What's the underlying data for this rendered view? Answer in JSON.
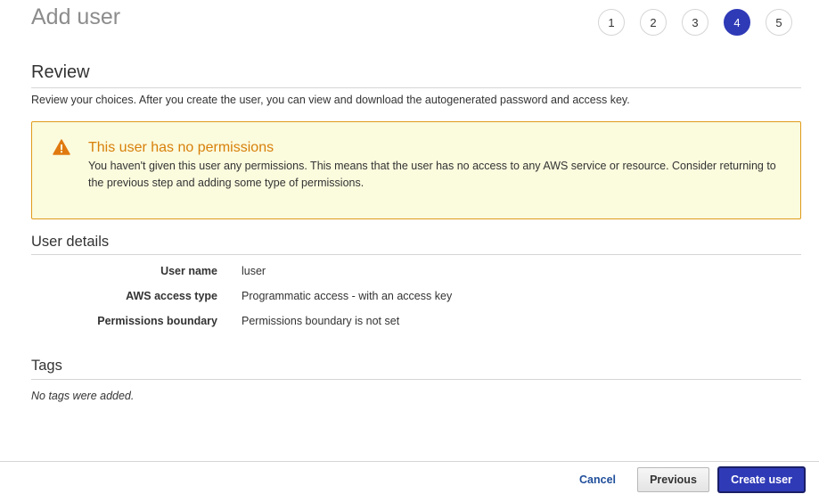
{
  "page_title": "Add user",
  "steps": [
    {
      "label": "1",
      "active": false
    },
    {
      "label": "2",
      "active": false
    },
    {
      "label": "3",
      "active": false
    },
    {
      "label": "4",
      "active": true
    },
    {
      "label": "5",
      "active": false
    }
  ],
  "review": {
    "heading": "Review",
    "description": "Review your choices. After you create the user, you can view and download the autogenerated password and access key."
  },
  "warning": {
    "icon": "warning-triangle-icon",
    "title": "This user has no permissions",
    "text": "You haven't given this user any permissions. This means that the user has no access to any AWS service or resource. Consider returning to the previous step and adding some type of permissions."
  },
  "user_details": {
    "heading": "User details",
    "rows": [
      {
        "label": "User name",
        "value": "luser"
      },
      {
        "label": "AWS access type",
        "value": "Programmatic access - with an access key"
      },
      {
        "label": "Permissions boundary",
        "value": "Permissions boundary is not set"
      }
    ]
  },
  "tags": {
    "heading": "Tags",
    "empty_text": "No tags were added."
  },
  "footer": {
    "cancel_label": "Cancel",
    "previous_label": "Previous",
    "create_label": "Create user"
  },
  "colors": {
    "accent": "#2f3ab7",
    "warning_border": "#e09b1a",
    "warning_background": "#fbfbde",
    "warning_title": "#d8800a",
    "link": "#1f4e9a"
  }
}
